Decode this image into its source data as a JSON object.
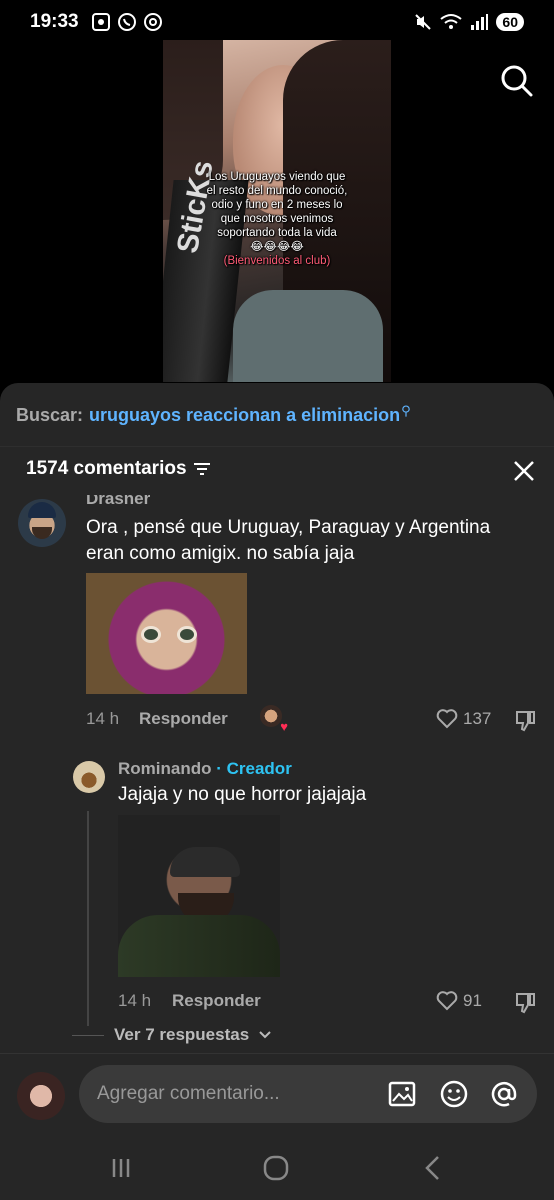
{
  "status_bar": {
    "time": "19:33",
    "battery": "60"
  },
  "video": {
    "caption_lines": [
      "Los Uruguayos viendo",
      "que el resto del mundo",
      "conoció, odio y funo en",
      "2 meses lo que nosotros",
      "venimos soportando",
      "toda la vida"
    ],
    "emojis": "😂😂😂😂",
    "tag": "(Bienvenidos al club)",
    "bottle_text": "SticKs"
  },
  "search": {
    "label": "Buscar:",
    "query": "uruguayos reaccionan a eliminacion"
  },
  "comments_header": {
    "count": "1574 comentarios"
  },
  "comments": [
    {
      "user": "Drasner",
      "text_lines": [
        "Ora , pensé que Uruguay, Paraguay y Argentina",
        "eran como amigix. no sabía jaja"
      ],
      "time": "14 h",
      "reply_label": "Responder",
      "likes": "137"
    },
    {
      "user": "Rominando",
      "badge": "· Creador",
      "text": "Jajaja y no que horror jajajaja",
      "time": "14 h",
      "reply_label": "Responder",
      "likes": "91"
    }
  ],
  "more_replies": "Ver 7 respuestas",
  "input": {
    "placeholder": "Agregar comentario..."
  },
  "icons": {
    "search": "search-icon",
    "close": "close-icon",
    "sort": "sort-icon",
    "heart": "heart-icon",
    "dislike": "dislike-icon",
    "image": "image-icon",
    "emoji": "emoji-icon",
    "mention": "at-icon"
  },
  "colors": {
    "sheet_bg": "#262626",
    "link_blue": "#5fb4ff",
    "creator_cyan": "#2ec3f2"
  }
}
